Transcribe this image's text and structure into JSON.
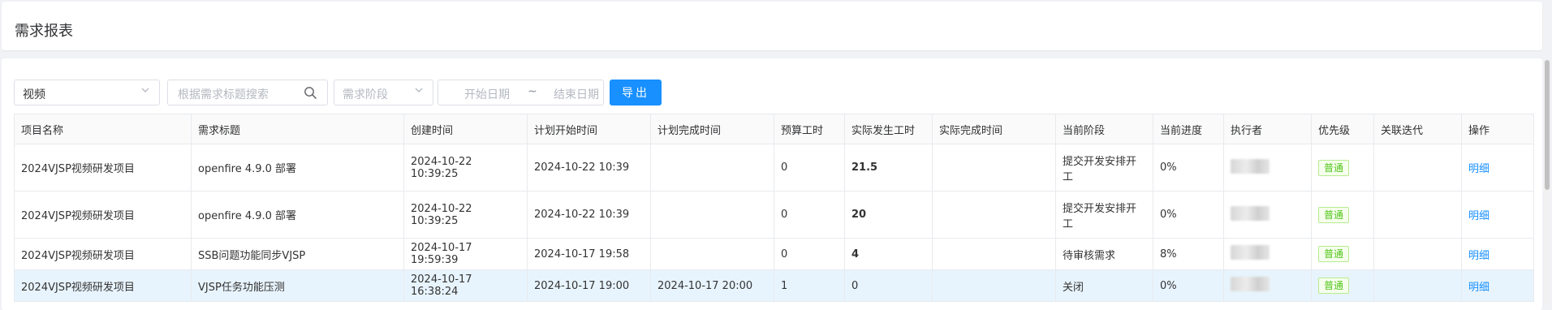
{
  "page": {
    "title": "需求报表"
  },
  "filters": {
    "project_select": {
      "value": "视频"
    },
    "search": {
      "placeholder": "根据需求标题搜索"
    },
    "stage_select": {
      "placeholder": "需求阶段"
    },
    "date_range": {
      "start_placeholder": "开始日期",
      "separator": "~",
      "end_placeholder": "结束日期"
    },
    "export_label": "导出"
  },
  "table": {
    "columns": [
      "项目名称",
      "需求标题",
      "创建时间",
      "计划开始时间",
      "计划完成时间",
      "预算工时",
      "实际发生工时",
      "实际完成时间",
      "当前阶段",
      "当前进度",
      "执行者",
      "优先级",
      "关联迭代",
      "操作"
    ],
    "rows": [
      {
        "project": "2024VJSP视频研发项目",
        "title": "openfire 4.9.0 部署",
        "created": "2024-10-22 10:39:25",
        "plan_start": "2024-10-22 10:39",
        "plan_end": "",
        "budget": "0",
        "actual": "21.5",
        "actual_end": "",
        "stage": "提交开发安排开工",
        "progress": "0%",
        "priority": "普通",
        "iteration": "",
        "action": "明细"
      },
      {
        "project": "2024VJSP视频研发项目",
        "title": "openfire 4.9.0 部署",
        "created": "2024-10-22 10:39:25",
        "plan_start": "2024-10-22 10:39",
        "plan_end": "",
        "budget": "0",
        "actual": "20",
        "actual_end": "",
        "stage": "提交开发安排开工",
        "progress": "0%",
        "priority": "普通",
        "iteration": "",
        "action": "明细"
      },
      {
        "project": "2024VJSP视频研发项目",
        "title": "SSB问题功能同步VJSP",
        "created": "2024-10-17 19:59:39",
        "plan_start": "2024-10-17 19:58",
        "plan_end": "",
        "budget": "0",
        "actual": "4",
        "actual_end": "",
        "stage": "待审核需求",
        "progress": "8%",
        "priority": "普通",
        "iteration": "",
        "action": "明细"
      },
      {
        "project": "2024VJSP视频研发项目",
        "title": "VJSP任务功能压测",
        "created": "2024-10-17 16:38:24",
        "plan_start": "2024-10-17 19:00",
        "plan_end": "2024-10-17 20:00",
        "budget": "1",
        "actual": "0",
        "actual_end": "",
        "stage": "关闭",
        "progress": "0%",
        "priority": "普通",
        "iteration": "",
        "action": "明细"
      }
    ]
  },
  "colors": {
    "accent": "#1890ff",
    "hours_highlight": "#e02020",
    "tag_green": "#52c41a",
    "selected_row": "#e8f4fd"
  },
  "icons": {
    "search": "search-icon",
    "dropdown": "chevron-down-icon"
  }
}
